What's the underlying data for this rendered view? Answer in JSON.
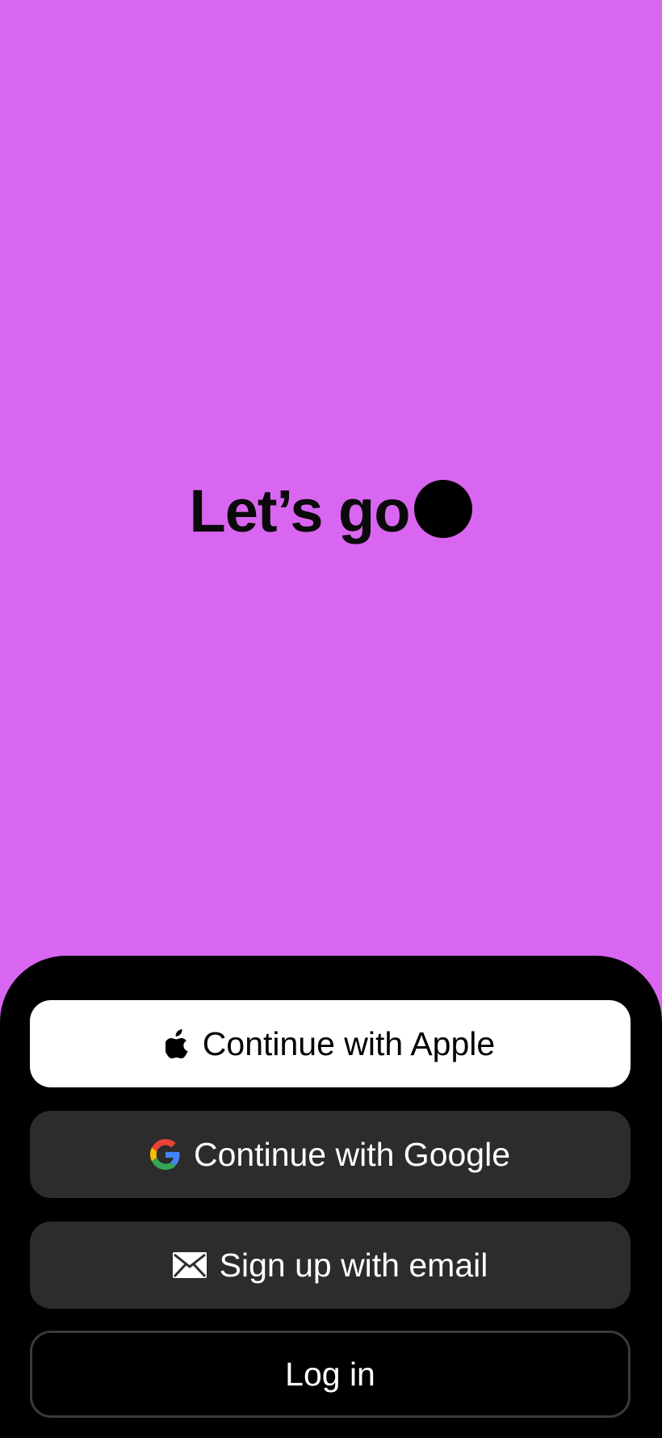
{
  "hero": {
    "title": "Let’s go",
    "background_color": "#d966f0"
  },
  "auth_sheet": {
    "background_color": "#000000",
    "apple_label": "Continue with Apple",
    "google_label": "Continue with Google",
    "email_label": "Sign up with email",
    "login_label": "Log in",
    "icons": {
      "apple": "apple-icon",
      "google": "google-icon",
      "email": "mail-icon"
    }
  }
}
